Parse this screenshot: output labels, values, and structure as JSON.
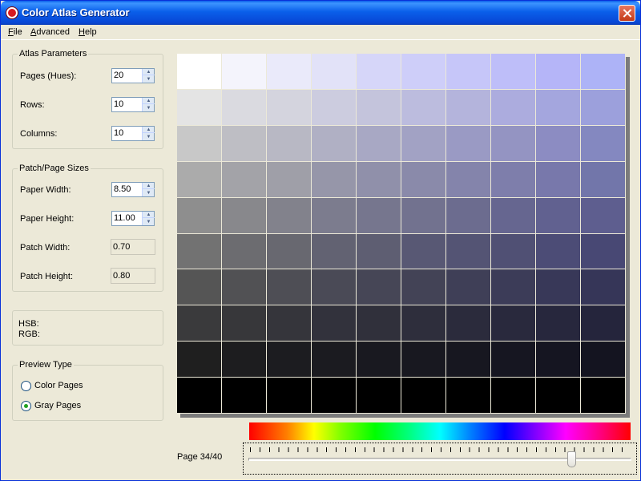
{
  "window": {
    "title": "Color Atlas Generator"
  },
  "menu": {
    "file": "File",
    "file_mn": "F",
    "file_rest": "ile",
    "advanced_mn": "A",
    "advanced_rest": "dvanced",
    "help_mn": "H",
    "help_rest": "elp"
  },
  "atlas_params": {
    "legend": "Atlas Parameters",
    "pages_label": "Pages (Hues):",
    "pages_value": "20",
    "rows_label": "Rows:",
    "rows_value": "10",
    "columns_label": "Columns:",
    "columns_value": "10"
  },
  "sizes": {
    "legend": "Patch/Page Sizes",
    "paper_width_label": "Paper Width:",
    "paper_width_value": "8.50",
    "paper_height_label": "Paper Height:",
    "paper_height_value": "11.00",
    "patch_width_label": "Patch Width:",
    "patch_width_value": "0.70",
    "patch_height_label": "Patch Height:",
    "patch_height_value": "0.80"
  },
  "info": {
    "hsb_label": "HSB:",
    "rgb_label": "RGB:"
  },
  "preview": {
    "legend": "Preview Type",
    "color_pages": "Color Pages",
    "gray_pages": "Gray Pages",
    "selected": "gray"
  },
  "page_indicator": "Page 34/40",
  "slider": {
    "current_page": 34,
    "total_pages": 40,
    "tick_count": 40
  },
  "grid_colors": [
    [
      "#ffffff",
      "#f4f4fc",
      "#eaeafa",
      "#e2e2f8",
      "#d6d6f9",
      "#cecef9",
      "#c6c6f9",
      "#bebef9",
      "#b5b5f8",
      "#adb3f7"
    ],
    [
      "#e4e4e4",
      "#dadae0",
      "#d4d4de",
      "#ccccdf",
      "#c4c4dc",
      "#bcbcde",
      "#b4b4dc",
      "#acacde",
      "#a4a6de",
      "#9ca0dc"
    ],
    [
      "#c8c8c8",
      "#bebec4",
      "#b8b8c4",
      "#b0b0c4",
      "#a8a8c4",
      "#a2a2c4",
      "#9a9ac4",
      "#9494c2",
      "#8c8cc2",
      "#8488c0"
    ],
    [
      "#ababab",
      "#a3a3a8",
      "#9f9fa8",
      "#9696a9",
      "#9090aa",
      "#8a8aaa",
      "#8484ab",
      "#7e7eab",
      "#7878ab",
      "#7276aa"
    ],
    [
      "#8e8e8e",
      "#88888c",
      "#82828c",
      "#7c7c8e",
      "#76768e",
      "#72728f",
      "#6c6c8f",
      "#666690",
      "#616190",
      "#5e5e8f"
    ],
    [
      "#727272",
      "#6c6c70",
      "#686870",
      "#626272",
      "#5e5e72",
      "#585874",
      "#545474",
      "#505074",
      "#4c4c76",
      "#484874"
    ],
    [
      "#555555",
      "#515154",
      "#4e4e55",
      "#4a4a56",
      "#464656",
      "#434356",
      "#3f3f57",
      "#3c3c58",
      "#383858",
      "#363658"
    ],
    [
      "#3a3a3c",
      "#37373a",
      "#35353b",
      "#32323c",
      "#30303b",
      "#2e2e3c",
      "#2b2b3c",
      "#29293d",
      "#27273d",
      "#25253c"
    ],
    [
      "#1f1f1f",
      "#1d1d1f",
      "#1c1c20",
      "#1b1b20",
      "#191920",
      "#181820",
      "#171720",
      "#161621",
      "#151521",
      "#141420"
    ],
    [
      "#000000",
      "#000000",
      "#000000",
      "#000000",
      "#000000",
      "#000000",
      "#000000",
      "#000000",
      "#000000",
      "#000000"
    ]
  ]
}
